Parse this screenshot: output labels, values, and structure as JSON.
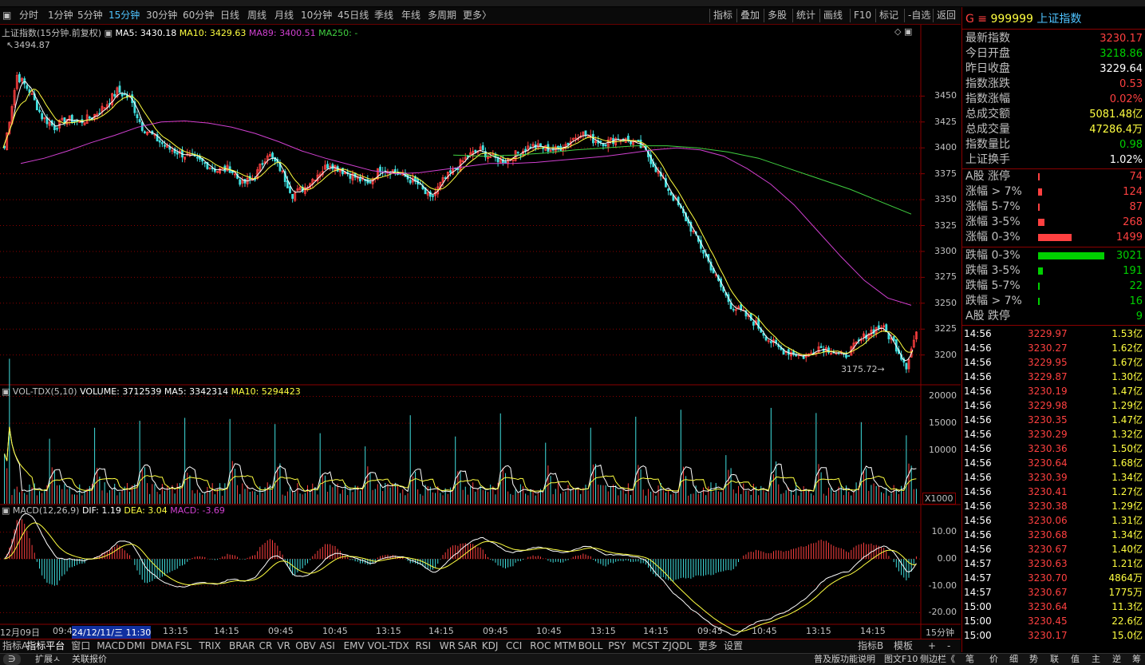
{
  "toolbar": {
    "periods": [
      "分时",
      "1分钟",
      "5分钟",
      "15分钟",
      "30分钟",
      "60分钟",
      "日线",
      "周线",
      "月线",
      "10分钟",
      "45日线",
      "季线",
      "年线",
      "多周期",
      "更多〉"
    ],
    "active_period": "15分钟",
    "tools": [
      "指标",
      "叠加",
      "多股",
      "统计",
      "画线",
      "F10",
      "标记",
      "-自选",
      "返回"
    ]
  },
  "main_legend": {
    "title": "上证指数(15分钟.前复权)",
    "ma5": "MA5: 3430.18",
    "ma10": "MA10: 3429.63",
    "ma89": "MA89: 3400.51",
    "ma250": "MA250: -"
  },
  "annotations": {
    "high": "3494.87",
    "low": "3175.72"
  },
  "vol_legend": {
    "name": "VOL-TDX(5,10)",
    "volume": "VOLUME: 3712539",
    "ma5": "MA5: 3342314",
    "ma10": "MA10: 5294423"
  },
  "macd_legend": {
    "name": "MACD(12,26,9)",
    "dif": "DIF: 1.19",
    "dea": "DEA: 3.04",
    "macd": "MACD: -3.69"
  },
  "axes": {
    "price_ticks": [
      "3450",
      "3425",
      "3400",
      "3375",
      "3350",
      "3325",
      "3300",
      "3275",
      "3250",
      "3225",
      "3200"
    ],
    "volume_ticks": [
      "20000",
      "15000",
      "10000"
    ],
    "volume_unit": "X1000",
    "macd_ticks": [
      "10.00",
      "0.00",
      "-10.00",
      "-20.00"
    ],
    "x_labels": [
      "12月09日",
      "09:4",
      "24/12/11/三 11:30",
      "13:15",
      "14:15",
      "09:45",
      "10:45",
      "13:15",
      "14:15",
      "09:45",
      "10:45",
      "13:15",
      "14:15",
      "09:45",
      "10:45",
      "13:15",
      "14:15"
    ],
    "period_label": "15分钟"
  },
  "indicator_tabs": [
    "指标A",
    "指标平台",
    "窗口",
    "MACD",
    "DMI",
    "DMA",
    "FSL",
    "TRIX",
    "BRAR",
    "CR",
    "VR",
    "OBV",
    "ASI",
    "EMV",
    "VOL-TDX",
    "RSI",
    "WR",
    "SAR",
    "KDJ",
    "CCI",
    "ROC",
    "MTM",
    "BOLL",
    "PSY",
    "MCST",
    "ZJQDL",
    "更多",
    "设置"
  ],
  "indicator_tabs_right": [
    "指标B",
    "模板",
    "+",
    "-"
  ],
  "status": {
    "left": [
      "扩展ㅅ",
      "关联报价"
    ],
    "right": [
      "普及版功能说明",
      "图文F10",
      "侧边栏《",
      "笔",
      "价",
      "细",
      "势",
      "联",
      "值",
      "主",
      "逆",
      "筹"
    ]
  },
  "quote": {
    "code": "999999",
    "name": "上证指数",
    "prefix": "G ≡",
    "rows": [
      {
        "label": "最新指数",
        "value": "3230.17",
        "color": "#ff4040"
      },
      {
        "label": "今日开盘",
        "value": "3218.86",
        "color": "#00d000"
      },
      {
        "label": "昨日收盘",
        "value": "3229.64",
        "color": "#ffffff"
      },
      {
        "label": "指数涨跌",
        "value": "0.53",
        "color": "#ff4040"
      },
      {
        "label": "指数涨幅",
        "value": "0.02%",
        "color": "#ff4040"
      },
      {
        "label": "总成交额",
        "value": "5081.48亿",
        "color": "#ffff40"
      },
      {
        "label": "总成交量",
        "value": "47286.4万",
        "color": "#ffff40"
      },
      {
        "label": "指数量比",
        "value": "0.98",
        "color": "#00d000"
      },
      {
        "label": "上证换手",
        "value": "1.02%",
        "color": "#ffffff"
      }
    ],
    "breadth_up": [
      {
        "label": "A股 涨停",
        "value": "74",
        "bar": 0.02
      },
      {
        "label": "涨幅 > 7%",
        "value": "124",
        "bar": 0.06
      },
      {
        "label": "涨幅 5-7%",
        "value": "87",
        "bar": 0.03
      },
      {
        "label": "涨幅 3-5%",
        "value": "268",
        "bar": 0.1
      },
      {
        "label": "涨幅 0-3%",
        "value": "1499",
        "bar": 0.5
      }
    ],
    "breadth_down": [
      {
        "label": "跌幅 0-3%",
        "value": "3021",
        "bar": 1.0
      },
      {
        "label": "跌幅 3-5%",
        "value": "191",
        "bar": 0.07
      },
      {
        "label": "跌幅 5-7%",
        "value": "22",
        "bar": 0.015
      },
      {
        "label": "跌幅 > 7%",
        "value": "16",
        "bar": 0.015
      },
      {
        "label": "A股 跌停",
        "value": "9",
        "bar": 0.0
      }
    ],
    "ticks": [
      {
        "t": "14:56",
        "p": "3229.97",
        "v": "1.53亿"
      },
      {
        "t": "14:56",
        "p": "3230.27",
        "v": "1.62亿"
      },
      {
        "t": "14:56",
        "p": "3229.95",
        "v": "1.67亿"
      },
      {
        "t": "14:56",
        "p": "3229.87",
        "v": "1.30亿"
      },
      {
        "t": "14:56",
        "p": "3230.19",
        "v": "1.47亿"
      },
      {
        "t": "14:56",
        "p": "3229.98",
        "v": "1.29亿"
      },
      {
        "t": "14:56",
        "p": "3230.35",
        "v": "1.47亿"
      },
      {
        "t": "14:56",
        "p": "3230.29",
        "v": "1.32亿"
      },
      {
        "t": "14:56",
        "p": "3230.36",
        "v": "1.50亿"
      },
      {
        "t": "14:56",
        "p": "3230.64",
        "v": "1.68亿"
      },
      {
        "t": "14:56",
        "p": "3230.39",
        "v": "1.34亿"
      },
      {
        "t": "14:56",
        "p": "3230.41",
        "v": "1.27亿"
      },
      {
        "t": "14:56",
        "p": "3230.38",
        "v": "1.29亿"
      },
      {
        "t": "14:56",
        "p": "3230.06",
        "v": "1.31亿"
      },
      {
        "t": "14:56",
        "p": "3230.68",
        "v": "1.34亿"
      },
      {
        "t": "14:56",
        "p": "3230.67",
        "v": "1.40亿"
      },
      {
        "t": "14:57",
        "p": "3230.63",
        "v": "1.21亿"
      },
      {
        "t": "14:57",
        "p": "3230.70",
        "v": "4864万"
      },
      {
        "t": "14:57",
        "p": "3230.67",
        "v": "1775万"
      },
      {
        "t": "15:00",
        "p": "3230.64",
        "v": "11.3亿"
      },
      {
        "t": "15:00",
        "p": "3230.45",
        "v": "22.6亿"
      },
      {
        "t": "15:00",
        "p": "3230.17",
        "v": "15.0亿"
      }
    ]
  },
  "colors": {
    "up": "#ff4040",
    "down": "#00d000",
    "grid": "#8a0000",
    "ma5": "#ffffff",
    "ma10": "#ffff40",
    "ma89": "#d040d0",
    "ma250": "#40d040"
  },
  "chart_data": {
    "type": "candlestick",
    "title": "上证指数(15分钟.前复权)",
    "ylim": [
      3172,
      3505
    ],
    "close_path": [
      3400,
      3470,
      3455,
      3430,
      3420,
      3428,
      3425,
      3430,
      3440,
      3455,
      3448,
      3420,
      3410,
      3400,
      3395,
      3390,
      3385,
      3378,
      3380,
      3365,
      3372,
      3395,
      3380,
      3355,
      3362,
      3375,
      3385,
      3378,
      3372,
      3365,
      3380,
      3378,
      3372,
      3365,
      3350,
      3368,
      3380,
      3392,
      3398,
      3390,
      3388,
      3395,
      3402,
      3400,
      3398,
      3405,
      3415,
      3408,
      3405,
      3410,
      3406,
      3400,
      3380,
      3360,
      3340,
      3318,
      3295,
      3270,
      3248,
      3240,
      3230,
      3215,
      3205,
      3202,
      3198,
      3208,
      3205,
      3198,
      3210,
      3222,
      3228,
      3212,
      3190,
      3230
    ],
    "ma89_path": [
      3385,
      3390,
      3397,
      3405,
      3412,
      3420,
      3425,
      3426,
      3424,
      3420,
      3414,
      3406,
      3397,
      3390,
      3384,
      3378,
      3375,
      3376,
      3379,
      3382,
      3385,
      3385,
      3386,
      3388,
      3390,
      3392,
      3395,
      3398,
      3400,
      3398,
      3392,
      3380,
      3365,
      3345,
      3320,
      3295,
      3272,
      3255,
      3248
    ],
    "ma250_path": [
      3393,
      3392,
      3393,
      3395,
      3398,
      3400,
      3402,
      3402,
      3400,
      3396,
      3390,
      3380,
      3370,
      3360,
      3348,
      3336
    ],
    "high_label": "3494.87",
    "low_label": "3175.72"
  }
}
